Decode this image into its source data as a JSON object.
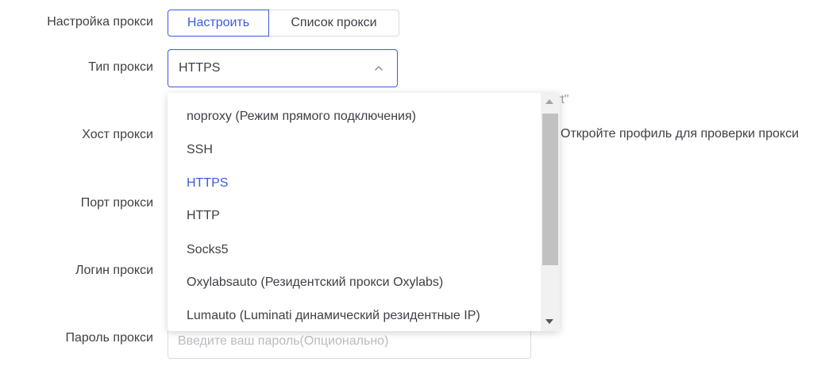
{
  "form": {
    "proxy_setting_label": "Настройка прокси",
    "proxy_type_label": "Тип прокси",
    "proxy_host_label": "Хост прокси",
    "proxy_port_label": "Порт прокси",
    "proxy_login_label": "Логин прокси",
    "proxy_password_label": "Пароль прокси"
  },
  "setting_toggle": {
    "configure_label": "Настроить",
    "proxy_list_label": "Список прокси",
    "active": "configure"
  },
  "proxy_type_select": {
    "value": "HTTPS",
    "icon": "chevron-up-icon"
  },
  "dropdown": {
    "options": [
      "noproxy (Режим прямого подключения)",
      "SSH",
      "HTTPS",
      "HTTP",
      "Socks5",
      "Oxylabsauto (Резидентский прокси Oxylabs)",
      "Lumauto (Luminati динамический резидентные IP)"
    ],
    "selected_index": 2
  },
  "hints": {
    "partial_text": "rt\"",
    "profile_hint": "Откройте профиль для проверки прокси"
  },
  "password_input": {
    "placeholder": "Введите ваш пароль(Опционально)"
  },
  "colors": {
    "accent": "#3b5bdb",
    "text": "#3d4047",
    "border": "#d9dce3",
    "placeholder": "#b8bcc4"
  }
}
